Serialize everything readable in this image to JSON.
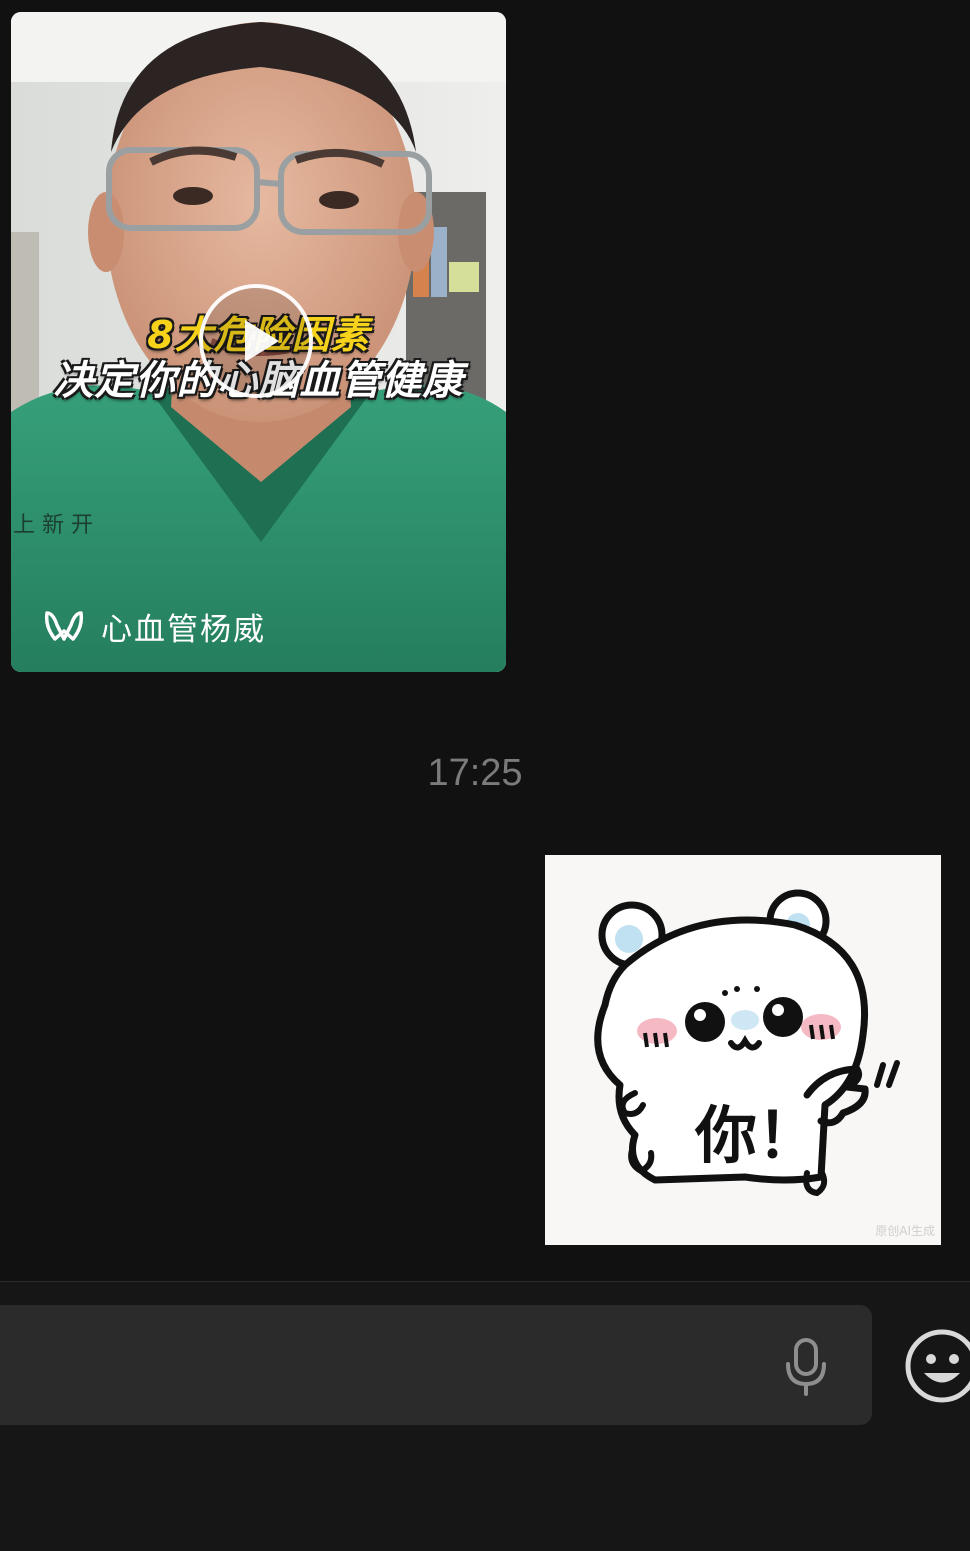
{
  "chat": {
    "video_card": {
      "caption_line1": "8大危险因素",
      "caption_line2": "决定你的心脑血管健康",
      "channel_name": "心血管杨威",
      "channel_icon": "channels-logo-icon",
      "play_icon": "play-icon"
    },
    "timestamp": "17:25",
    "sticker": {
      "text": "你！",
      "watermark": "原创AI生成"
    }
  },
  "input_bar": {
    "mic_icon": "microphone-icon",
    "emoji_icon": "emoji-smile-icon"
  },
  "colors": {
    "background": "#111111",
    "input_field": "#2b2b2b",
    "timestamp": "#7b7b7b",
    "caption_highlight": "#f6d21b"
  }
}
